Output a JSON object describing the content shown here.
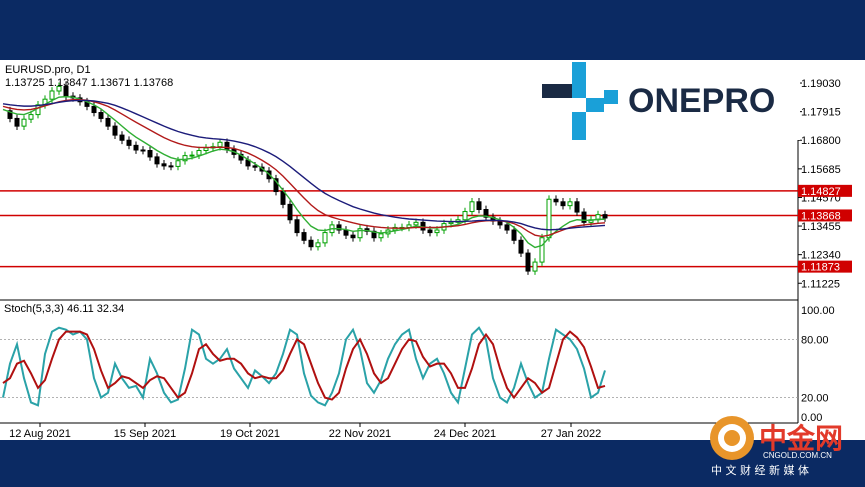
{
  "header": {
    "symbol": "EURUSD.pro, D1",
    "ohlc": "1.13725 1.13847 1.13671 1.13768"
  },
  "indicator": {
    "label": "Stoch(5,3,3) 46.11 32.34"
  },
  "logo": {
    "text": "ONEPRO",
    "color": "#1a2a44",
    "accent": "#1aa0d8"
  },
  "watermark": {
    "cn_name": "中金网",
    "domain": "CNGOLD.COM.CN",
    "slogan": "中 文 财 经 新 媒 体"
  },
  "colors": {
    "background": "#0b2a63",
    "price_line": "#d00000",
    "up": "#00a000",
    "down": "#000000",
    "ma_fast": "#2fae33",
    "ma_mid": "#b21a1a",
    "ma_slow": "#1c1c7a",
    "stoch_main": "#2aa2a8",
    "stoch_signal": "#b01010"
  },
  "chart_data": [
    {
      "type": "line",
      "title": "EURUSD.pro, D1",
      "x_tick_labels": [
        "12 Aug 2021",
        "15 Sep 2021",
        "19 Oct 2021",
        "22 Nov 2021",
        "24 Dec 2021",
        "27 Jan 2022"
      ],
      "y_tick_labels": [
        "1.19030",
        "1.17915",
        "1.16800",
        "1.15685",
        "1.14570",
        "1.13455",
        "1.12340",
        "1.11225"
      ],
      "ylim": [
        1.1065,
        1.1985
      ],
      "horizontal_lines": [
        {
          "label": "1.14827",
          "value": 1.14827
        },
        {
          "label": "1.13868",
          "value": 1.13868
        },
        {
          "label": "1.11873",
          "value": 1.11873
        }
      ],
      "series": [
        {
          "values": [
            1.1795,
            1.1765,
            1.1735,
            1.1762,
            1.178,
            1.1818,
            1.184,
            1.1872,
            1.189,
            1.1852,
            1.1845,
            1.183,
            1.1812,
            1.1788,
            1.1765,
            1.1735,
            1.17,
            1.168,
            1.166,
            1.1642,
            1.164,
            1.1615,
            1.1588,
            1.158,
            1.1578,
            1.16,
            1.162,
            1.1622,
            1.164,
            1.165,
            1.1655,
            1.1672,
            1.1645,
            1.1625,
            1.1603,
            1.158,
            1.1575,
            1.156,
            1.153,
            1.148,
            1.143,
            1.137,
            1.132,
            1.129,
            1.1265,
            1.128,
            1.132,
            1.135,
            1.133,
            1.131,
            1.13,
            1.1335,
            1.1325,
            1.13,
            1.1315,
            1.133,
            1.134,
            1.134,
            1.135,
            1.136,
            1.133,
            1.132,
            1.133,
            1.1355,
            1.136,
            1.137,
            1.1402,
            1.144,
            1.141,
            1.138,
            1.1365,
            1.135,
            1.133,
            1.129,
            1.124,
            1.117,
            1.1205,
            1.13,
            1.145,
            1.144,
            1.1425,
            1.144,
            1.14,
            1.136,
            1.137,
            1.139,
            1.1377
          ]
        },
        {
          "values": [
            1.18,
            1.179,
            1.1782,
            1.178,
            1.179,
            1.1805,
            1.182,
            1.1835,
            1.1848,
            1.185,
            1.1848,
            1.184,
            1.183,
            1.1818,
            1.1802,
            1.178,
            1.1758,
            1.1735,
            1.1712,
            1.1692,
            1.1675,
            1.1658,
            1.164,
            1.1625,
            1.1612,
            1.1605,
            1.1605,
            1.161,
            1.1618,
            1.1628,
            1.1638,
            1.1645,
            1.1642,
            1.1635,
            1.1622,
            1.1605,
            1.1588,
            1.157,
            1.1548,
            1.152,
            1.1485,
            1.145,
            1.141,
            1.1375,
            1.1345,
            1.133,
            1.1328,
            1.1335,
            1.1335,
            1.1332,
            1.1325,
            1.1328,
            1.1328,
            1.1322,
            1.1318,
            1.1322,
            1.1327,
            1.1332,
            1.1338,
            1.1345,
            1.1342,
            1.1338,
            1.1338,
            1.1342,
            1.1346,
            1.1352,
            1.1364,
            1.1378,
            1.1385,
            1.1384,
            1.1378,
            1.137,
            1.136,
            1.134,
            1.1315,
            1.128,
            1.1262,
            1.127,
            1.13,
            1.1325,
            1.1345,
            1.1362,
            1.137,
            1.1368,
            1.1368,
            1.1372,
            1.1372
          ]
        },
        {
          "values": [
            1.1812,
            1.1805,
            1.18,
            1.1798,
            1.18,
            1.1806,
            1.1814,
            1.1822,
            1.183,
            1.1835,
            1.1838,
            1.1838,
            1.1836,
            1.183,
            1.1822,
            1.1812,
            1.1798,
            1.1782,
            1.1766,
            1.175,
            1.1735,
            1.172,
            1.1705,
            1.169,
            1.1678,
            1.1668,
            1.166,
            1.1655,
            1.1652,
            1.1652,
            1.1652,
            1.1653,
            1.1652,
            1.1648,
            1.164,
            1.163,
            1.1617,
            1.1602,
            1.1585,
            1.1565,
            1.154,
            1.1512,
            1.1483,
            1.1455,
            1.1428,
            1.1406,
            1.139,
            1.138,
            1.1372,
            1.1365,
            1.1358,
            1.1352,
            1.1347,
            1.1343,
            1.134,
            1.1338,
            1.1337,
            1.1337,
            1.1338,
            1.134,
            1.134,
            1.134,
            1.134,
            1.1342,
            1.1344,
            1.1347,
            1.1352,
            1.1358,
            1.1363,
            1.1366,
            1.1367,
            1.1366,
            1.1363,
            1.1355,
            1.1343,
            1.1325,
            1.131,
            1.1305,
            1.131,
            1.132,
            1.133,
            1.134,
            1.1346,
            1.135,
            1.1353,
            1.1356,
            1.1358
          ]
        },
        {
          "values": [
            1.1822,
            1.1818,
            1.1815,
            1.1813,
            1.1813,
            1.1815,
            1.1819,
            1.1823,
            1.1828,
            1.1832,
            1.1834,
            1.1835,
            1.1835,
            1.1833,
            1.1829,
            1.1824,
            1.1816,
            1.1806,
            1.1795,
            1.1783,
            1.1771,
            1.1759,
            1.1747,
            1.1735,
            1.1724,
            1.1714,
            1.1706,
            1.1699,
            1.1693,
            1.1689,
            1.1686,
            1.1684,
            1.1681,
            1.1677,
            1.1671,
            1.1664,
            1.1655,
            1.1644,
            1.1631,
            1.1616,
            1.1598,
            1.1578,
            1.1556,
            1.1534,
            1.1512,
            1.1491,
            1.1473,
            1.1458,
            1.1445,
            1.1433,
            1.1421,
            1.1412,
            1.1404,
            1.1396,
            1.139,
            1.1385,
            1.138,
            1.1376,
            1.1373,
            1.1371,
            1.1369,
            1.1367,
            1.1365,
            1.1364,
            1.1363,
            1.1363,
            1.1364,
            1.1365,
            1.1367,
            1.1368,
            1.1368,
            1.1367,
            1.1365,
            1.1361,
            1.1355,
            1.1346,
            1.1338,
            1.1333,
            1.1331,
            1.1332,
            1.1334,
            1.1337,
            1.134,
            1.1342,
            1.1344,
            1.1346,
            1.1348
          ]
        }
      ]
    },
    {
      "type": "line",
      "title": "Stoch(5,3,3) 46.11 32.34",
      "y_tick_labels": [
        "100.00",
        "80.00",
        "20.00",
        "0.00"
      ],
      "ylim": [
        0,
        100
      ],
      "series": [
        {
          "values": [
            20,
            55,
            75,
            40,
            15,
            12,
            65,
            88,
            92,
            90,
            85,
            88,
            80,
            40,
            20,
            25,
            55,
            40,
            30,
            32,
            20,
            60,
            45,
            25,
            15,
            18,
            50,
            90,
            85,
            60,
            55,
            60,
            70,
            50,
            40,
            30,
            48,
            42,
            35,
            45,
            65,
            90,
            85,
            45,
            22,
            15,
            12,
            25,
            45,
            80,
            90,
            70,
            35,
            25,
            38,
            60,
            75,
            85,
            90,
            60,
            40,
            55,
            60,
            45,
            25,
            15,
            50,
            85,
            92,
            80,
            40,
            20,
            15,
            30,
            55,
            35,
            20,
            25,
            60,
            90,
            85,
            80,
            70,
            50,
            20,
            25,
            48
          ]
        },
        {
          "values": [
            35,
            40,
            55,
            58,
            45,
            30,
            38,
            60,
            80,
            88,
            88,
            88,
            85,
            70,
            48,
            30,
            35,
            42,
            40,
            35,
            30,
            38,
            42,
            40,
            30,
            20,
            25,
            45,
            70,
            75,
            65,
            58,
            60,
            60,
            55,
            45,
            40,
            42,
            40,
            40,
            48,
            65,
            80,
            75,
            55,
            35,
            20,
            18,
            25,
            50,
            70,
            80,
            65,
            45,
            35,
            40,
            55,
            70,
            80,
            78,
            62,
            52,
            55,
            55,
            45,
            30,
            30,
            50,
            75,
            85,
            75,
            50,
            30,
            20,
            30,
            40,
            35,
            25,
            30,
            55,
            80,
            88,
            82,
            72,
            52,
            30,
            32
          ]
        }
      ]
    }
  ]
}
